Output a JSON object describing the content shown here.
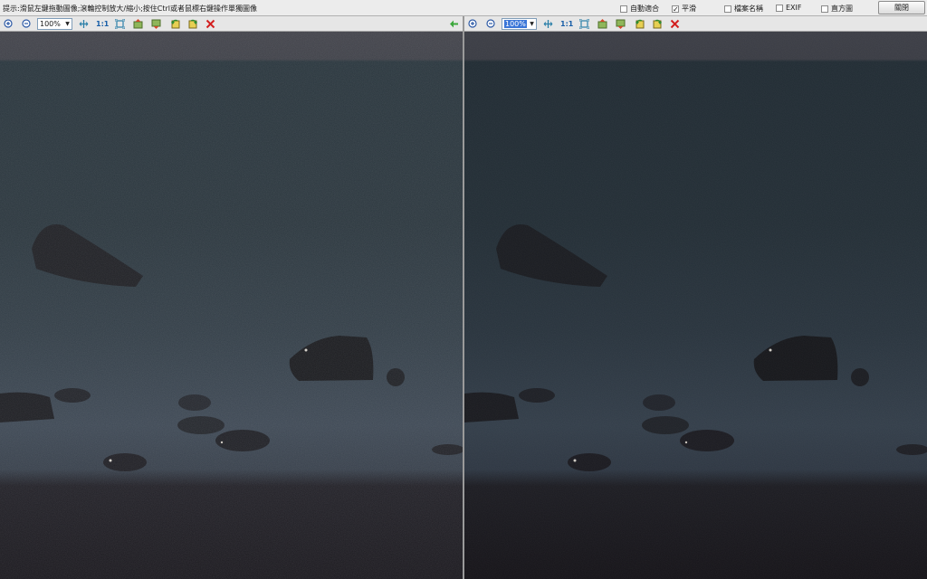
{
  "hint_text": "提示:滑鼠左鍵拖動圖像;滾輪控制放大/縮小;按住Ctrl或者鼠標右鍵操作單獨圖像",
  "options": {
    "auto_fit": {
      "label": "自動適合",
      "checked": false
    },
    "smooth": {
      "label": "平滑",
      "checked": true
    },
    "filename": {
      "label": "檔案名稱",
      "checked": false
    },
    "exif": {
      "label": "EXIF",
      "checked": false
    },
    "histogram": {
      "label": "直方圖",
      "checked": false
    }
  },
  "close_label": "關閉",
  "left_pane": {
    "zoom_value": "100%",
    "one_to_one": "1:1",
    "icons": [
      "zoom-in-icon",
      "zoom-out-icon",
      "fit-icon",
      "fullscreen-icon",
      "prev-image-icon",
      "next-image-icon",
      "rotate-left-icon",
      "rotate-right-icon",
      "close-icon",
      "sync-arrow-icon"
    ]
  },
  "right_pane": {
    "zoom_value": "100%",
    "one_to_one": "1:1",
    "icons": [
      "zoom-in-icon",
      "zoom-out-icon",
      "fit-icon",
      "fullscreen-icon",
      "prev-image-icon",
      "next-image-icon",
      "rotate-left-icon",
      "rotate-right-icon",
      "close-icon"
    ]
  },
  "colors": {
    "sky": "#3e3f47",
    "sea_top": "#233038",
    "sea_mid": "#2c3841",
    "fog": "#3b4652",
    "sand": "#16141a",
    "rock": "#17181c",
    "right_tint": "#1f2933",
    "accent_green": "#3ca83c",
    "close_red": "#d32020",
    "selection_blue": "#3a76d8"
  }
}
